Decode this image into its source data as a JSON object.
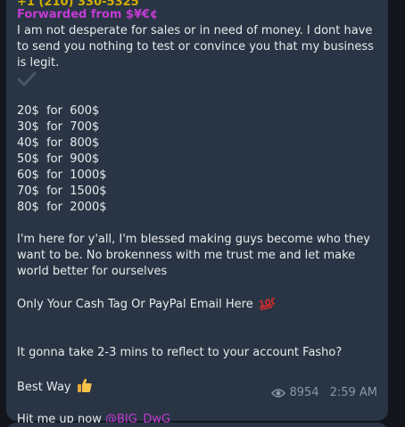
{
  "message": {
    "contact_line": "+1 (210) 330-5325",
    "forwarded_from": "Forwarded from $¥€¢",
    "intro": "I am not desperate for sales or in need of money. I dont have to send you nothing to test or convince you that my business is legit.",
    "check_icon": "check-icon",
    "price_list": [
      "20$  for  600$",
      "30$  for  700$",
      "40$  for  800$",
      "50$  for  900$",
      "60$  for  1000$",
      "70$  for  1500$",
      "80$  for  2000$"
    ],
    "blessed_text": "I'm here for y'all, I'm blessed making guys become who they want to be. No brokenness with me trust me and let make world better for ourselves",
    "cash_tag_text": "Only Your Cash Tag Or PayPal Email Here",
    "cash_tag_emoji": "hundred-points-icon",
    "reflect_text": "It gonna take 2-3 mins to reflect to your account Fasho?",
    "best_way_text": "Best Way",
    "best_way_emoji": "thumbs-up-icon",
    "hit_me_text": "Hit me up now",
    "mention": "@BIG_DwG",
    "views": "8954",
    "time": "2:59 AM"
  },
  "colors": {
    "bubble": "#293544",
    "background": "#12161c",
    "forwarded": "#c43bd4",
    "meta": "#8a96a6"
  }
}
